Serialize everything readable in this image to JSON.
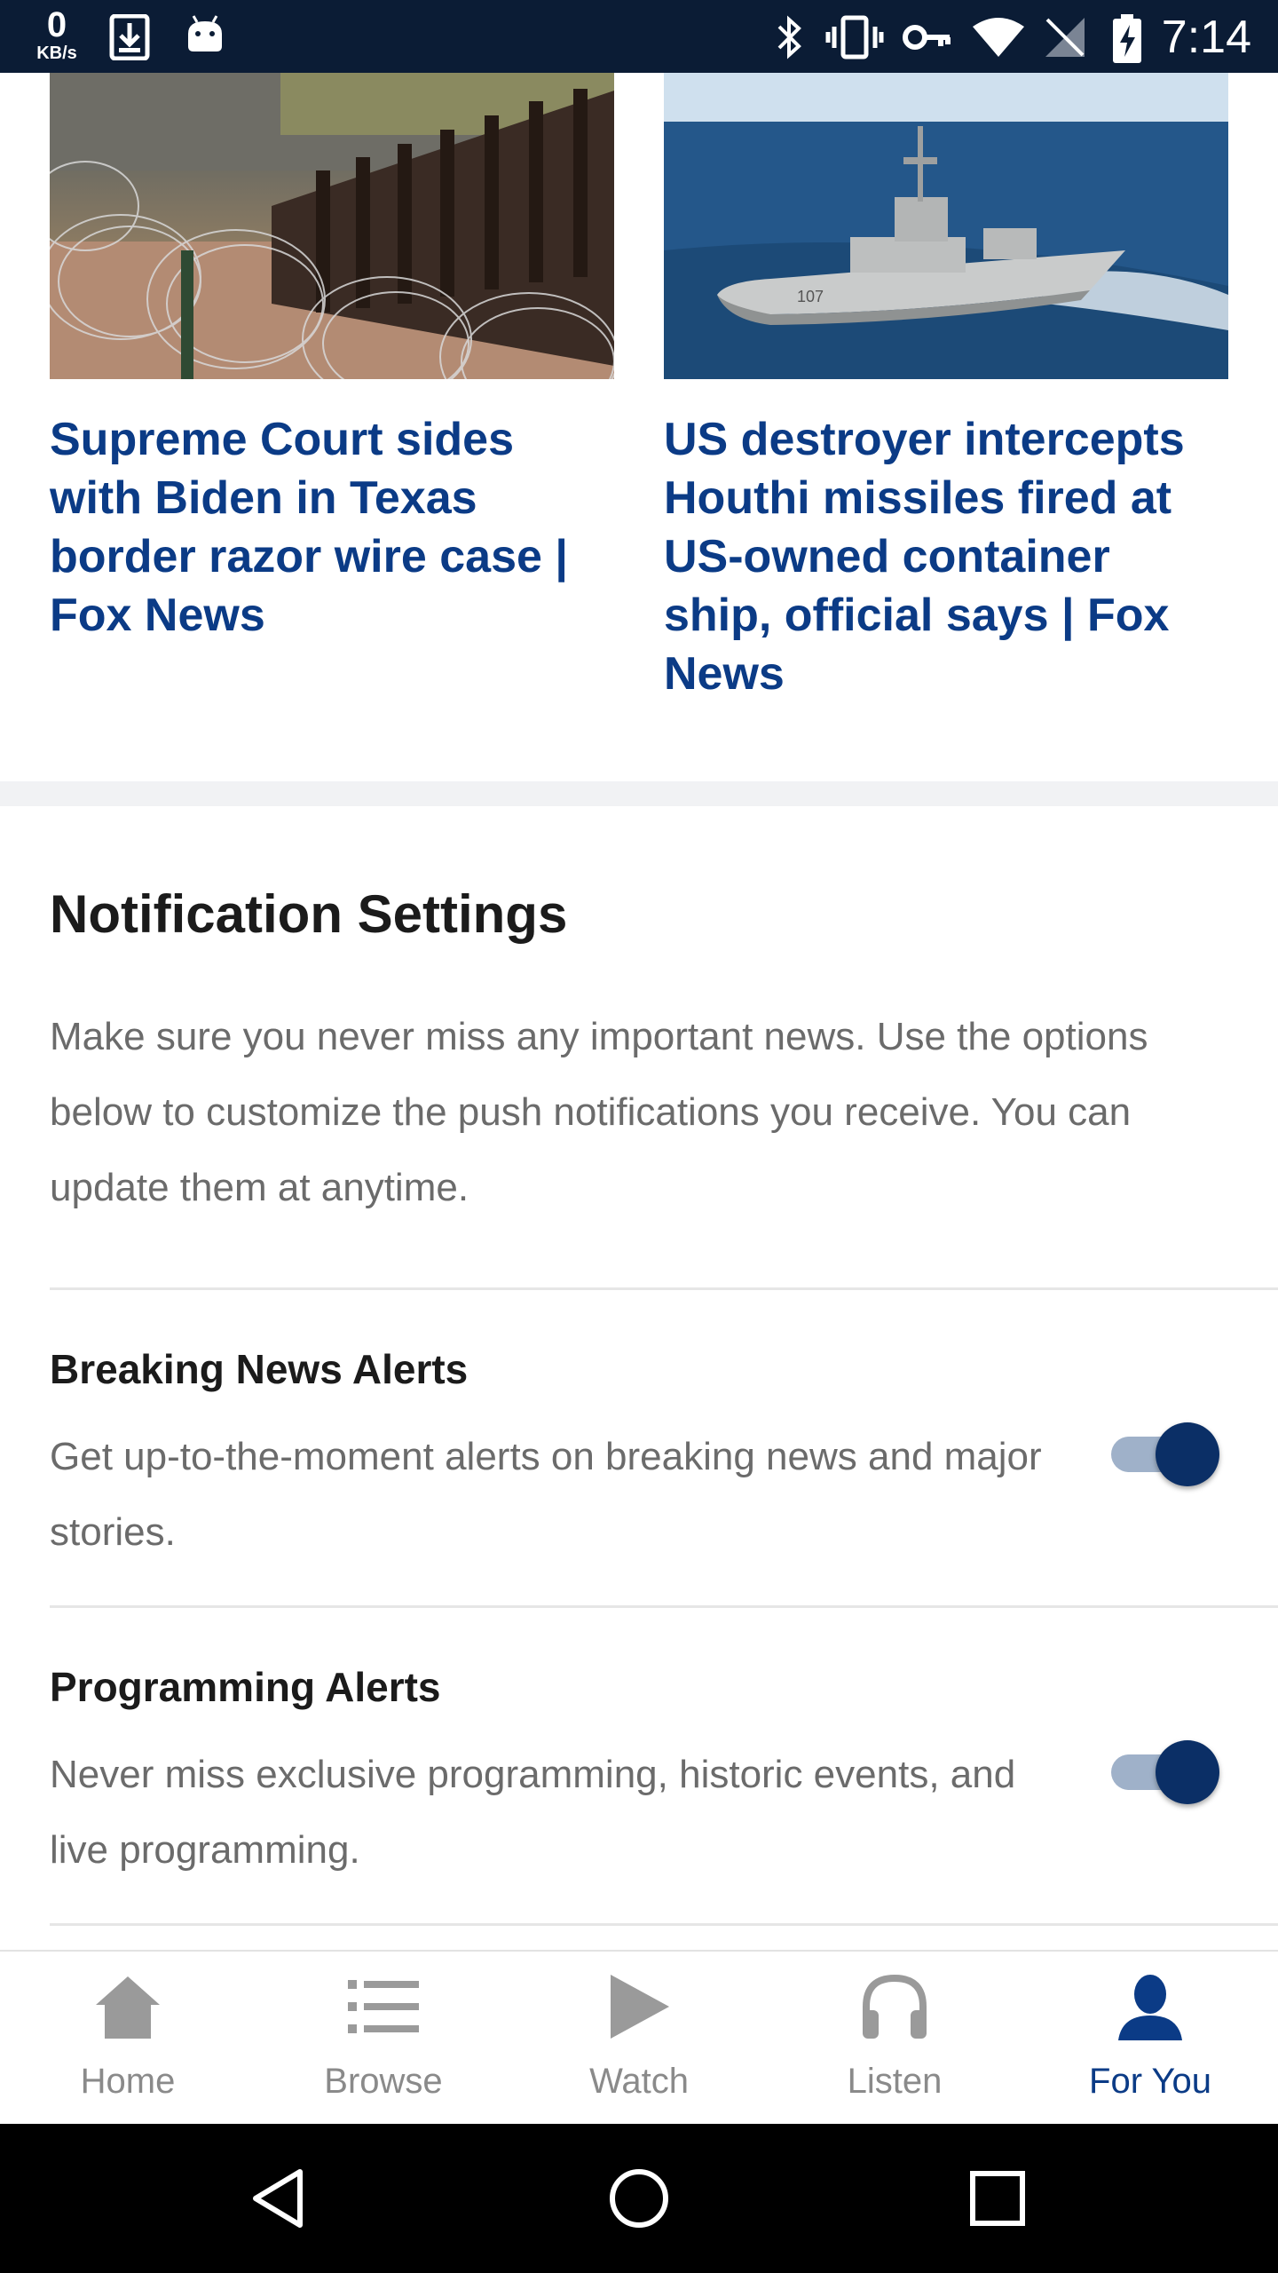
{
  "status_bar": {
    "speed_value": "0",
    "speed_unit": "KB/s",
    "time": "7:14",
    "icons": [
      "download-icon",
      "android-icon",
      "bluetooth-icon",
      "vibrate-icon",
      "vpn-key-icon",
      "wifi-icon",
      "no-signal-icon",
      "battery-charging-icon"
    ]
  },
  "articles": [
    {
      "headline": "Supreme Court sides with Biden in Texas border razor wire case | Fox News",
      "image": "razor-wire-border-photo"
    },
    {
      "headline": "US destroyer intercepts Houthi missiles fired at US-owned container ship, official says | Fox News",
      "image": "navy-destroyer-photo"
    }
  ],
  "notification_settings": {
    "title": "Notification Settings",
    "intro": "Make sure you never miss any important news. Use the options below to customize the push notifications you receive. You can update them at anytime.",
    "items": [
      {
        "title": "Breaking News Alerts",
        "description": "Get up-to-the-moment alerts on breaking news and major stories.",
        "enabled": true
      },
      {
        "title": "Programming Alerts",
        "description": "Never miss exclusive programming, historic events, and live programming.",
        "enabled": true
      }
    ]
  },
  "bottom_nav": {
    "items": [
      {
        "label": "Home",
        "icon": "home-icon"
      },
      {
        "label": "Browse",
        "icon": "list-icon"
      },
      {
        "label": "Watch",
        "icon": "play-icon"
      },
      {
        "label": "Listen",
        "icon": "headphones-icon"
      },
      {
        "label": "For You",
        "icon": "person-icon"
      }
    ],
    "active": "For You"
  },
  "colors": {
    "status_bar_bg": "#0b1c35",
    "headline": "#0b3b86",
    "toggle_on": "#0b2f66",
    "nav_active": "#0b3b86",
    "nav_inactive": "#8a8a8a"
  }
}
